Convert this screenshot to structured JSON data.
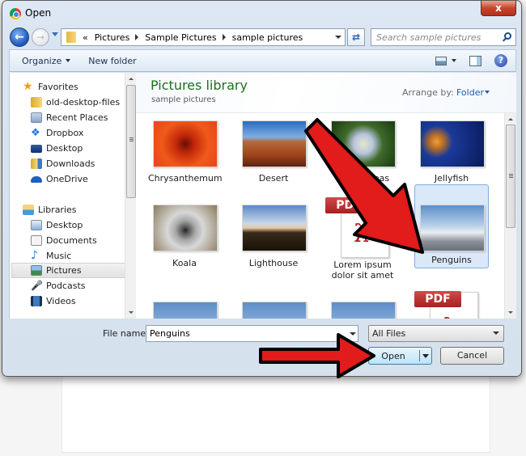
{
  "window": {
    "title": "Open",
    "close_label": "x"
  },
  "address_bar": {
    "overflow": "«",
    "segments": [
      "Pictures",
      "Sample Pictures",
      "sample pictures"
    ]
  },
  "search": {
    "placeholder": "Search sample pictures"
  },
  "toolbar": {
    "organize_label": "Organize",
    "new_folder_label": "New folder",
    "help_label": "?"
  },
  "nav_pane": {
    "favorites_label": "Favorites",
    "favorites": [
      {
        "label": "old-desktop-files",
        "icon": "folder-icon"
      },
      {
        "label": "Recent Places",
        "icon": "recent-places-icon"
      },
      {
        "label": "Dropbox",
        "icon": "dropbox-icon"
      },
      {
        "label": "Desktop",
        "icon": "desktop-icon"
      },
      {
        "label": "Downloads",
        "icon": "downloads-icon"
      },
      {
        "label": "OneDrive",
        "icon": "onedrive-icon"
      }
    ],
    "libraries_label": "Libraries",
    "libraries": [
      {
        "label": "Desktop",
        "icon": "desktop-library-icon"
      },
      {
        "label": "Documents",
        "icon": "documents-icon"
      },
      {
        "label": "Music",
        "icon": "music-icon"
      },
      {
        "label": "Pictures",
        "icon": "pictures-icon",
        "selected": true
      },
      {
        "label": "Podcasts",
        "icon": "podcasts-icon"
      },
      {
        "label": "Videos",
        "icon": "videos-icon"
      }
    ]
  },
  "content": {
    "library_title": "Pictures library",
    "library_subtitle": "sample pictures",
    "arrange_label": "Arrange by:",
    "arrange_value": "Folder",
    "files": [
      {
        "name": "Chrysanthemum",
        "type": "image"
      },
      {
        "name": "Desert",
        "type": "image"
      },
      {
        "name": "Hydrangeas",
        "type": "image"
      },
      {
        "name": "Jellyfish",
        "type": "image"
      },
      {
        "name": "Koala",
        "type": "image"
      },
      {
        "name": "Lighthouse",
        "type": "image"
      },
      {
        "name": "Lorem ipsum dolor sit amet",
        "type": "pdf"
      },
      {
        "name": "Penguins",
        "type": "image",
        "selected": true
      },
      {
        "name": "",
        "type": "image"
      },
      {
        "name": "",
        "type": "image"
      },
      {
        "name": "",
        "type": "image"
      },
      {
        "name": "",
        "type": "pdf"
      }
    ],
    "pdf_badge": "PDF"
  },
  "bottom": {
    "file_name_label": "File name:",
    "file_name_value": "Penguins",
    "file_type_value": "All Files",
    "open_label": "Open",
    "cancel_label": "Cancel"
  },
  "annotation_color": "#e21b1b"
}
